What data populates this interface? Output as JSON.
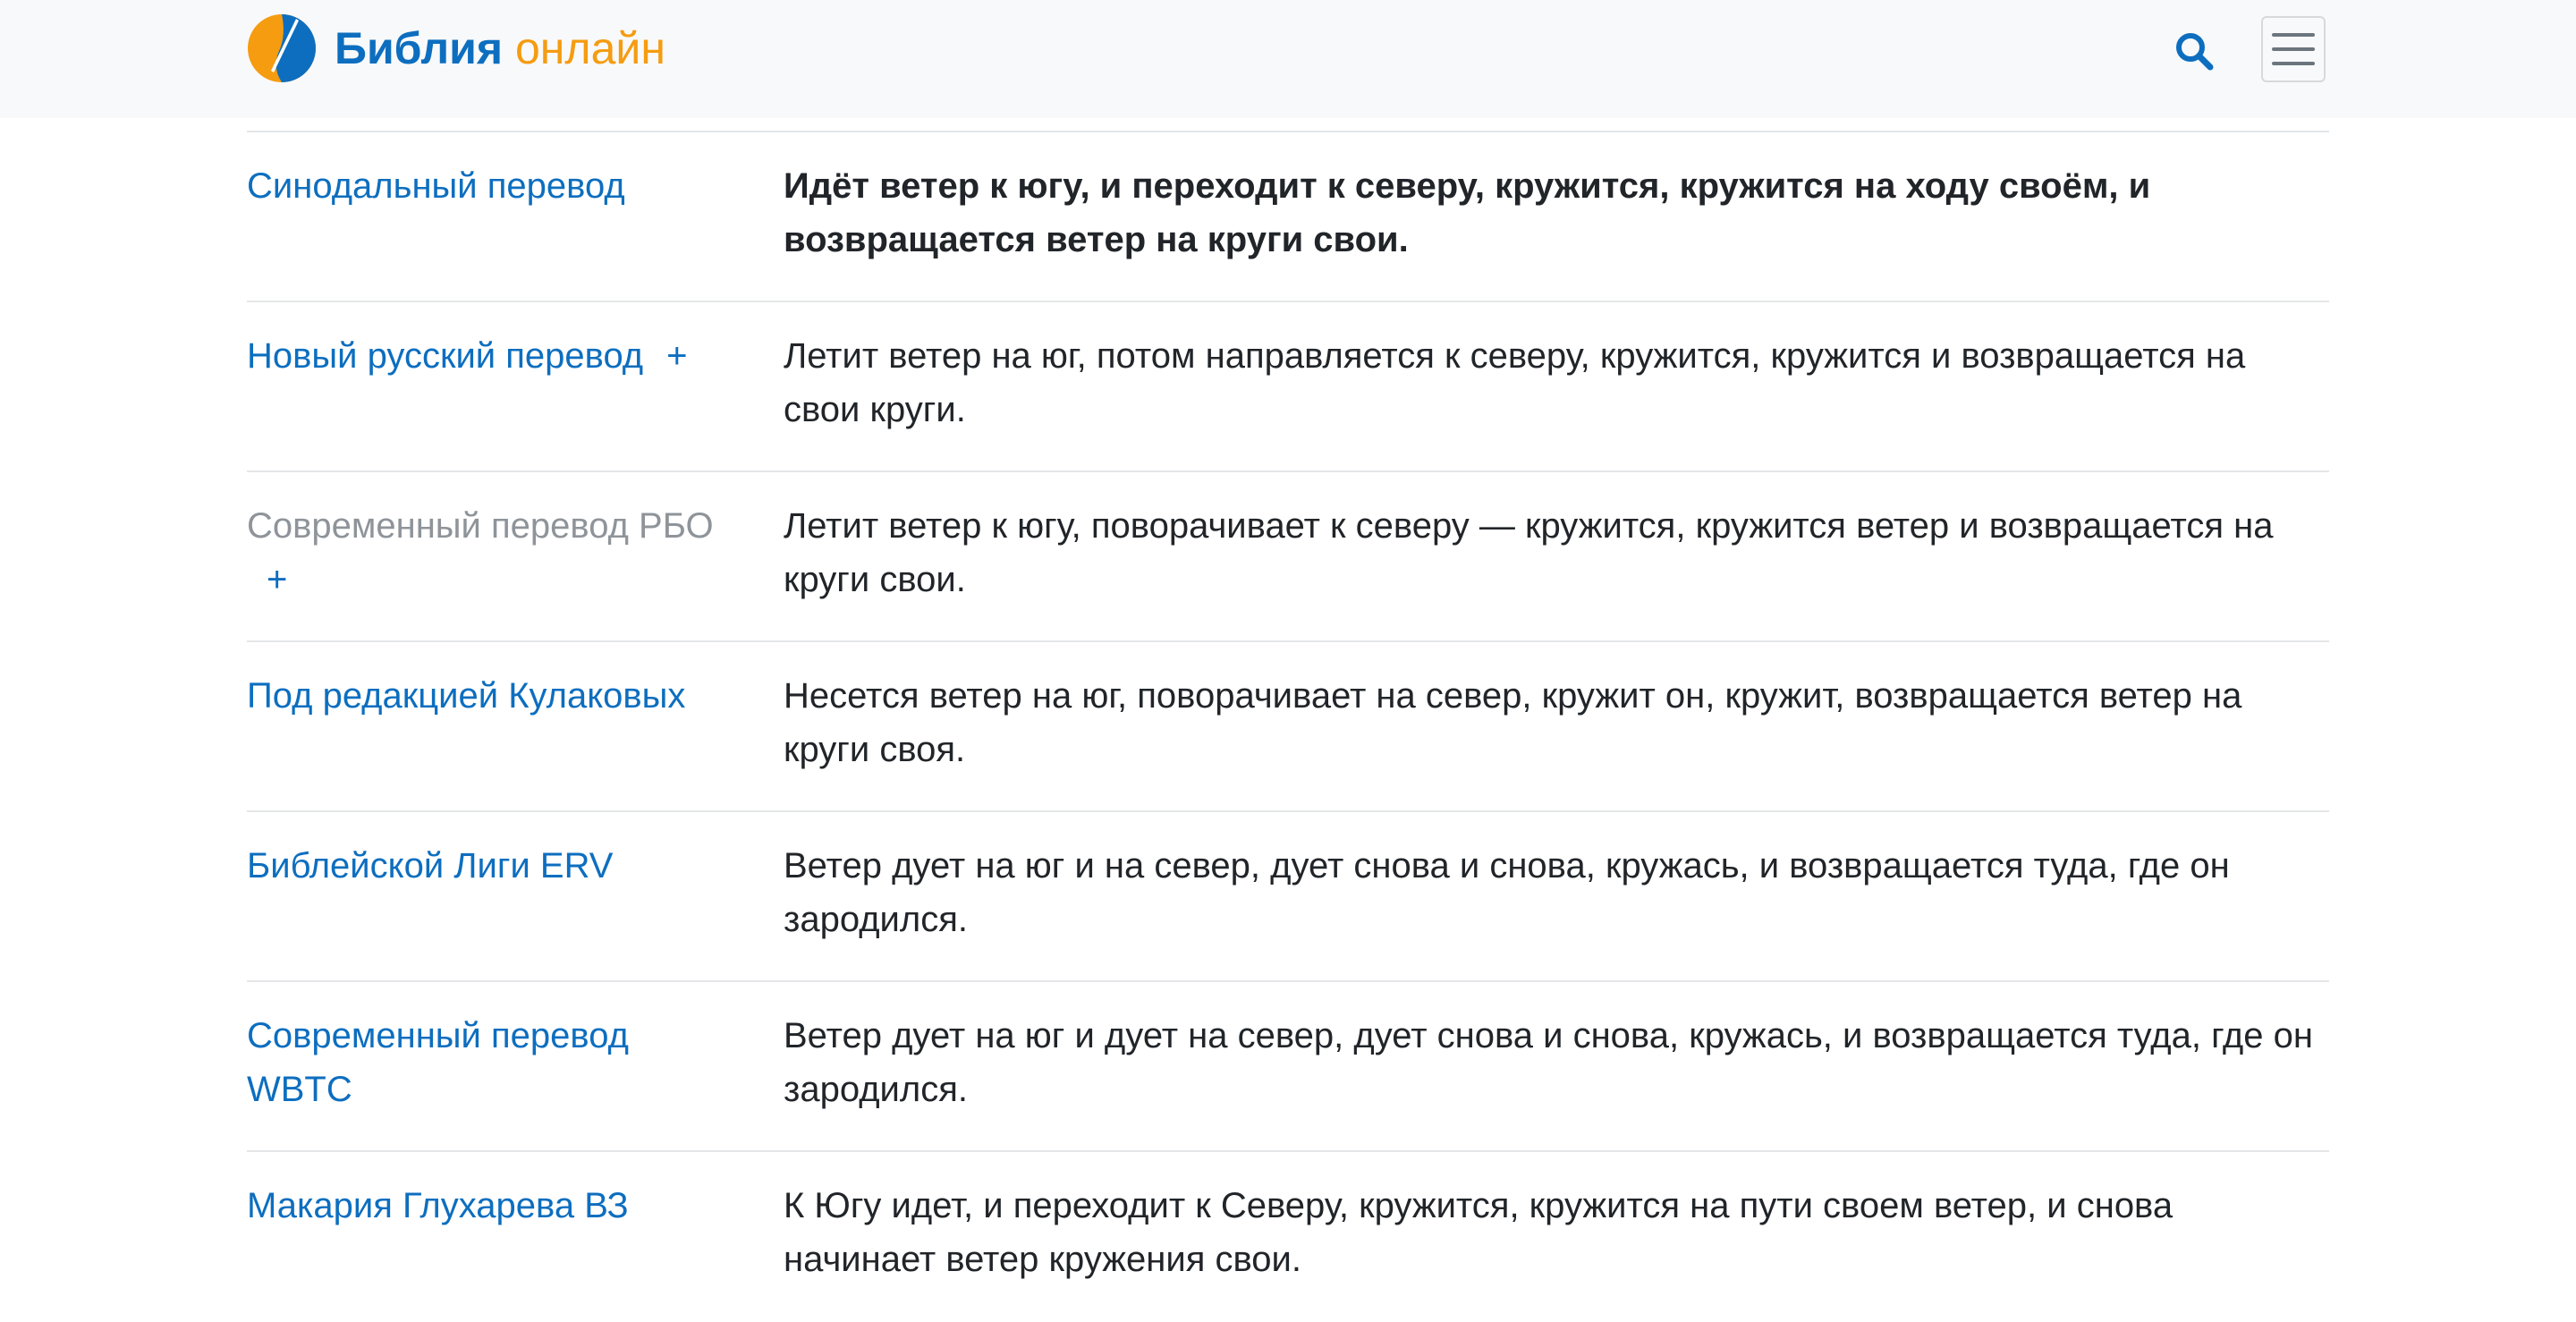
{
  "header": {
    "logo_word1": "Библия",
    "logo_word2": "онлайн",
    "search_icon": "search-icon",
    "menu_icon": "hamburger-menu-icon"
  },
  "colors": {
    "brand_blue": "#0d6ebf",
    "brand_orange": "#f59c11",
    "text": "#212529",
    "muted": "#8e9499"
  },
  "translations": [
    {
      "name": "Синодальный перевод",
      "text": "Идёт ветер к югу, и переходит к северу, кружится, кружится на ходу своём, и возвращается ветер на круги свои."
    },
    {
      "name": "Новый русский перевод",
      "plus": "+",
      "text": "Летит ветер на юг, потом направляется к северу, кружится, кружится и возвращается на свои круги."
    },
    {
      "name": "Современный перевод РБО",
      "plus": "+",
      "text": "Летит ветер к югу, поворачивает к северу — кружится, кружится ветер и возвращается на круги свои."
    },
    {
      "name": "Под редакцией Кулаковых",
      "text": "Несется ветер на юг, поворачивает на север, кружит он, кружит, возвращается ветер на круги своя."
    },
    {
      "name": "Библейской Лиги ERV",
      "text": "Ветер дует на юг и на север, дует снова и снова, кружась, и возвращается туда, где он зародился."
    },
    {
      "name": "Современный перевод WBTC",
      "text": "Ветер дует на юг и дует на север, дует снова и снова, кружась, и возвращается туда, где он зародился."
    },
    {
      "name": "Макария Глухарева ВЗ",
      "text": "К Югу идет, и переходит к Северу, кружится, кружится на пути своем ветер, и снова начинает ветер кружения свои."
    }
  ]
}
